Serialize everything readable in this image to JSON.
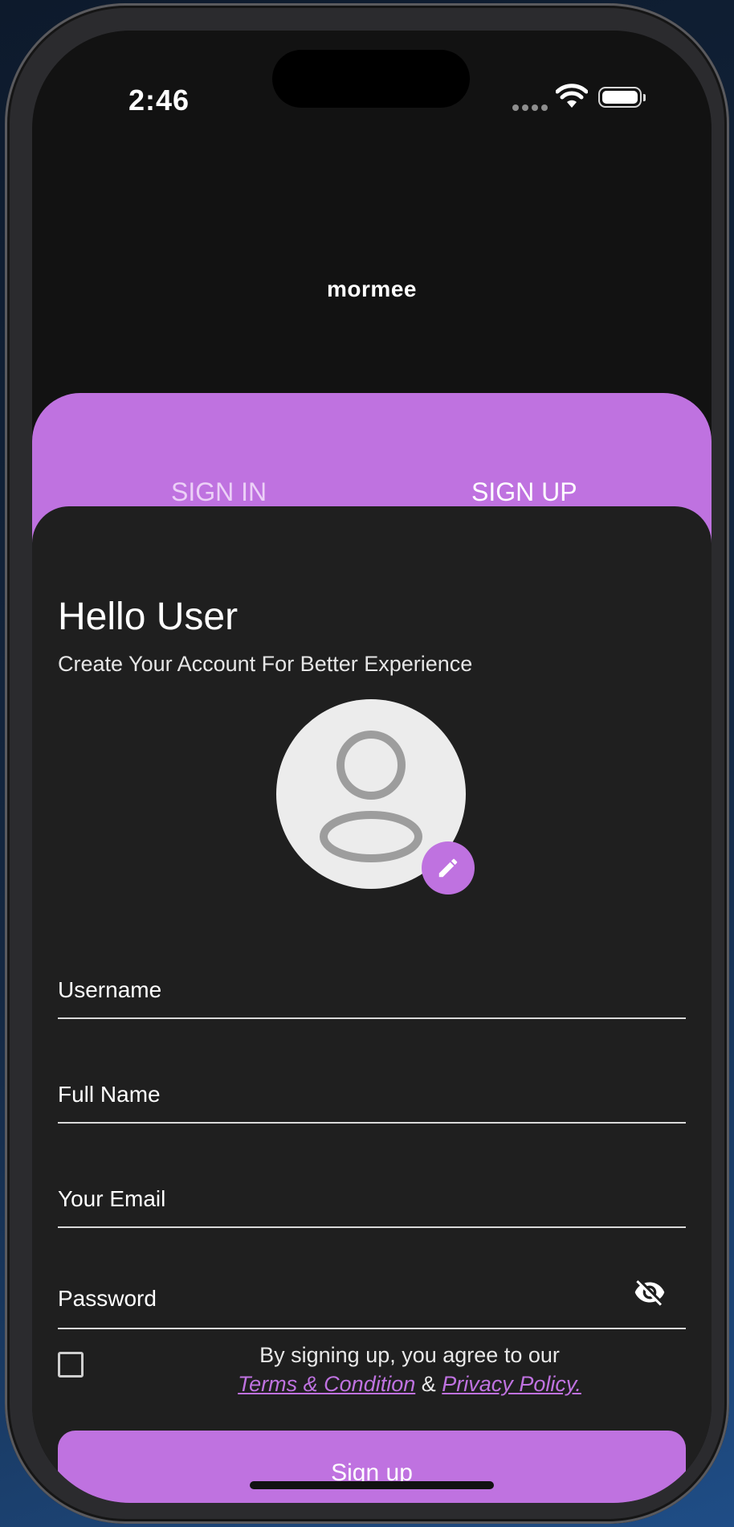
{
  "status": {
    "time": "2:46"
  },
  "brand": {
    "logo": "mormee"
  },
  "tabs": {
    "sign_in": "SIGN IN",
    "sign_up": "SIGN UP"
  },
  "header": {
    "title": "Hello User",
    "subtitle": "Create Your Account For Better Experience"
  },
  "form": {
    "username": "Username",
    "full_name": "Full Name",
    "email": "Your Email",
    "password": "Password"
  },
  "agreement": {
    "text": "By signing up, you agree to our",
    "terms": "Terms & Condition",
    "ampersand": "&",
    "privacy": "Privacy Policy."
  },
  "actions": {
    "signup": "Sign up"
  },
  "icons": {
    "avatar": "user-placeholder-icon",
    "edit": "pencil-icon",
    "password_toggle": "eye-off-icon"
  },
  "colors": {
    "accent": "#bf72e0",
    "card": "#1f1f1f",
    "background": "#121212"
  }
}
